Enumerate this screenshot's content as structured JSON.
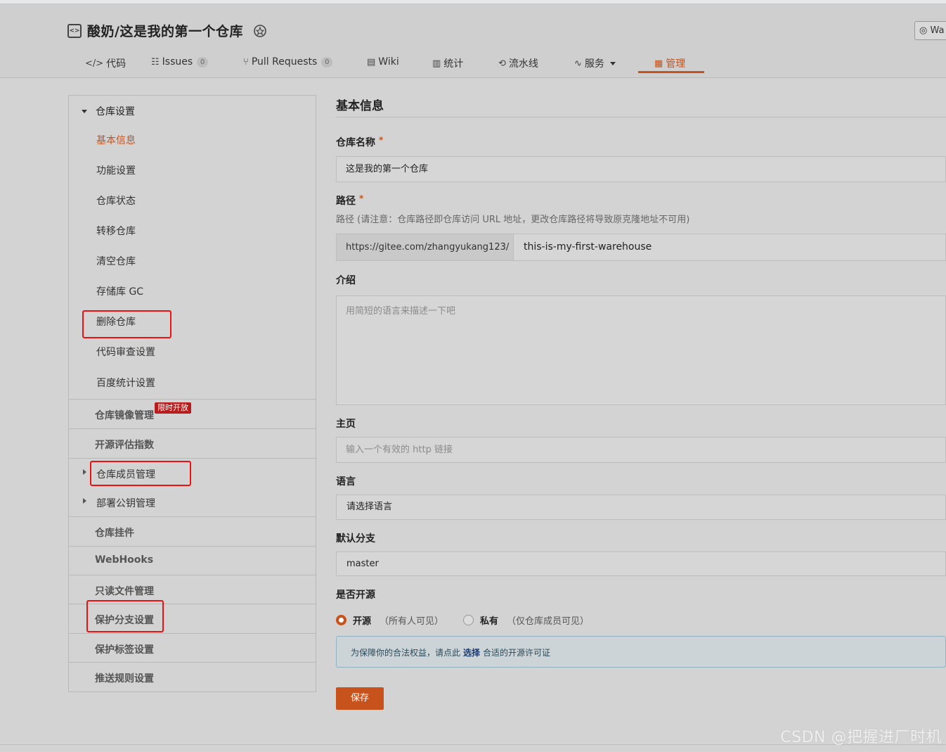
{
  "repo": {
    "title": "酸奶/这是我的第一个仓库",
    "watch_label": "Wa"
  },
  "tabs": [
    {
      "icon": "code-icon",
      "label": "代码"
    },
    {
      "icon": "issues-icon",
      "label": "Issues",
      "count": "0"
    },
    {
      "icon": "pull-request-icon",
      "label": "Pull Requests",
      "count": "0"
    },
    {
      "icon": "wiki-icon",
      "label": "Wiki"
    },
    {
      "icon": "stats-icon",
      "label": "统计"
    },
    {
      "icon": "pipeline-icon",
      "label": "流水线"
    },
    {
      "icon": "service-icon",
      "label": "服务"
    },
    {
      "icon": "manage-icon",
      "label": "管理",
      "active": true
    }
  ],
  "sidebar": {
    "group_title": "仓库设置",
    "sub_items": [
      "基本信息",
      "功能设置",
      "仓库状态",
      "转移仓库",
      "清空仓库",
      "存储库 GC",
      "删除仓库",
      "代码审查设置",
      "百度统计设置"
    ],
    "rows": [
      "仓库镜像管理",
      "开源评估指数",
      "仓库成员管理",
      "部署公钥管理",
      "仓库挂件",
      "WebHooks",
      "只读文件管理",
      "保护分支设置",
      "保护标签设置",
      "推送规则设置"
    ],
    "limited_tag": "限时开放"
  },
  "form": {
    "section_title": "基本信息",
    "name_label": "仓库名称",
    "required_mark": "*",
    "name_value": "这是我的第一个仓库",
    "path_label": "路径",
    "path_hint": "路径 (请注意：仓库路径即仓库访问 URL 地址，更改仓库路径将导致原克隆地址不可用)",
    "path_prefix": "https://gitee.com/zhangyukang123/",
    "path_value": "this-is-my-first-warehouse",
    "intro_label": "介绍",
    "intro_placeholder": "用简短的语言来描述一下吧",
    "homepage_label": "主页",
    "homepage_placeholder": "输入一个有效的 http 链接",
    "language_label": "语言",
    "language_value": "请选择语言",
    "branch_label": "默认分支",
    "branch_value": "master",
    "opensource_label": "是否开源",
    "radio_open": "开源",
    "radio_open_desc": "（所有人可见）",
    "radio_private": "私有",
    "radio_private_desc": "（仅仓库成员可见）",
    "notice_prefix": "为保障你的合法权益，请点此",
    "notice_link": "选择",
    "notice_suffix": "合适的开源许可证",
    "save_label": "保存"
  },
  "watermark": "CSDN @把握进厂时机",
  "colors": {
    "accent": "#c8521b",
    "highlight": "#e11111"
  }
}
